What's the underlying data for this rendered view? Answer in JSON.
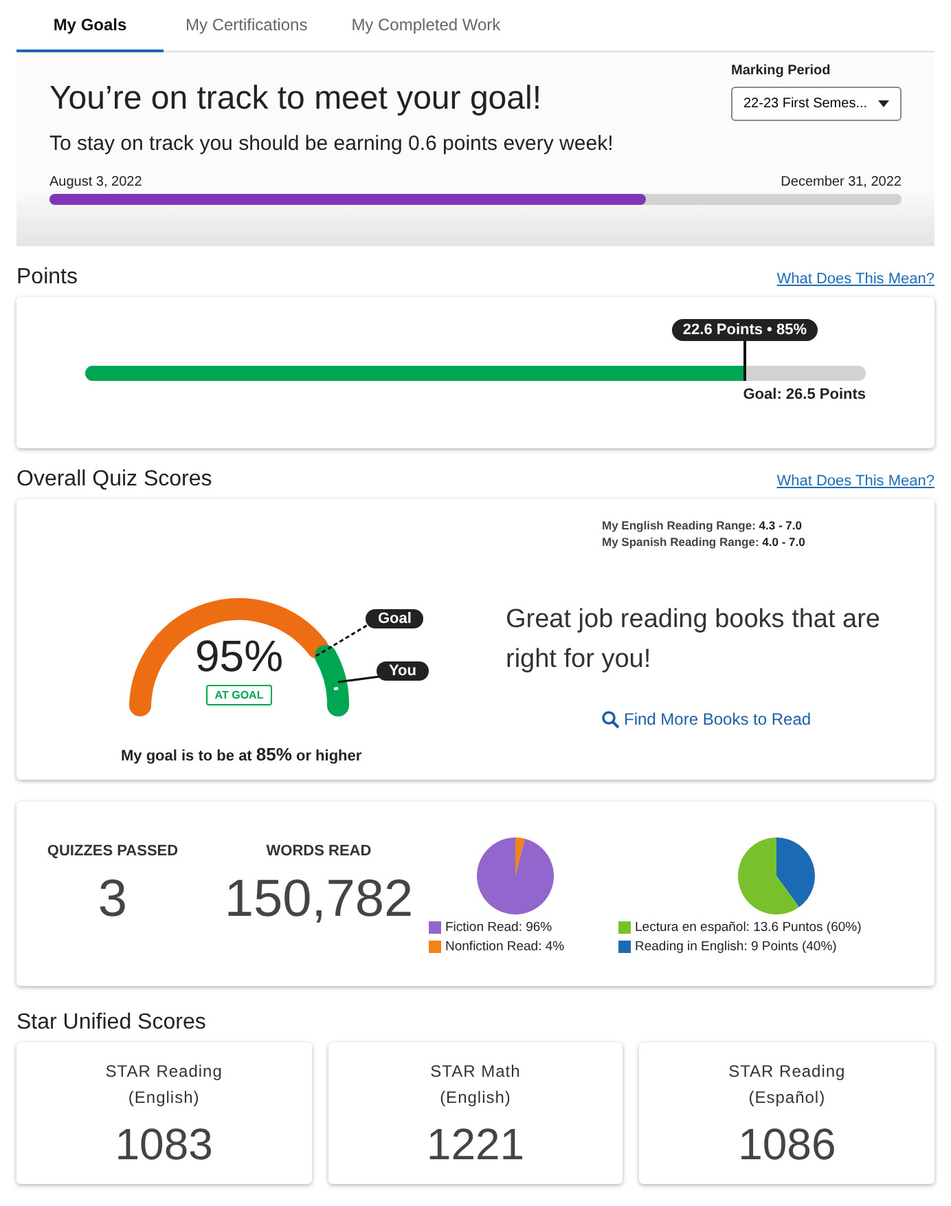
{
  "tabs": [
    {
      "label": "My Goals",
      "selected": true
    },
    {
      "label": "My Certifications",
      "selected": false
    },
    {
      "label": "My Completed Work",
      "selected": false
    }
  ],
  "goal_banner": {
    "headline": "You’re on track to meet your goal!",
    "subtext": "To stay on track you should be earning 0.6 points every week!",
    "start_date": "August 3, 2022",
    "end_date": "December 31, 2022",
    "level": 0.7,
    "marking_period": {
      "label": "Marking Period",
      "value": "22-23 First Semes..."
    }
  },
  "points": {
    "title": "Points",
    "help_link": "What Does This Mean?",
    "level": 0.845,
    "marker": "22.6 Points • 85%",
    "goal": "Goal: 26.5 Points"
  },
  "quiz_scores": {
    "title": "Overall Quiz Scores",
    "help_link": "What Does This Mean?",
    "score": "95%",
    "status": "AT GOAL",
    "goal_tag": "Goal",
    "you_tag": "You",
    "goal_note": "My goal is to be at **85%** or higher",
    "ranges": [
      {
        "label": "My English Reading Range:",
        "value": "4.3 - 7.0"
      },
      {
        "label": "My Spanish Reading Range:",
        "value": "4.0 - 7.0"
      }
    ],
    "message": "Great job reading books that are right for you!",
    "find_link": "Find More Books to Read"
  },
  "stats": [
    {
      "label": "QUIZZES PASSED",
      "value": "3"
    },
    {
      "label": "WORDS READ",
      "value": "150,782"
    }
  ],
  "pies": [
    {
      "chart_data": {
        "type": "pie",
        "values": [
          96,
          4
        ]
      },
      "legend": [
        {
          "label": "Fiction Read: 96%",
          "color": "#9266cc"
        },
        {
          "label": "Nonfiction Read: 4%",
          "color": "#f28317"
        }
      ]
    },
    {
      "chart_data": {
        "type": "pie",
        "values": [
          60,
          40
        ]
      },
      "legend": [
        {
          "label": "Lectura en español: 13.6 Puntos (60%)",
          "color": "#79c12c"
        },
        {
          "label": "Reading in English: 9 Points (40%)",
          "color": "#1a6bb3"
        }
      ]
    }
  ],
  "star_scores": {
    "title": "Star Unified Scores",
    "cards": [
      {
        "name": "STAR Reading",
        "language": "(English)",
        "score": "1083"
      },
      {
        "name": "STAR Math",
        "language": "(English)",
        "score": "1221"
      },
      {
        "name": "STAR Reading",
        "language": "(Español)",
        "score": "1086"
      }
    ]
  }
}
